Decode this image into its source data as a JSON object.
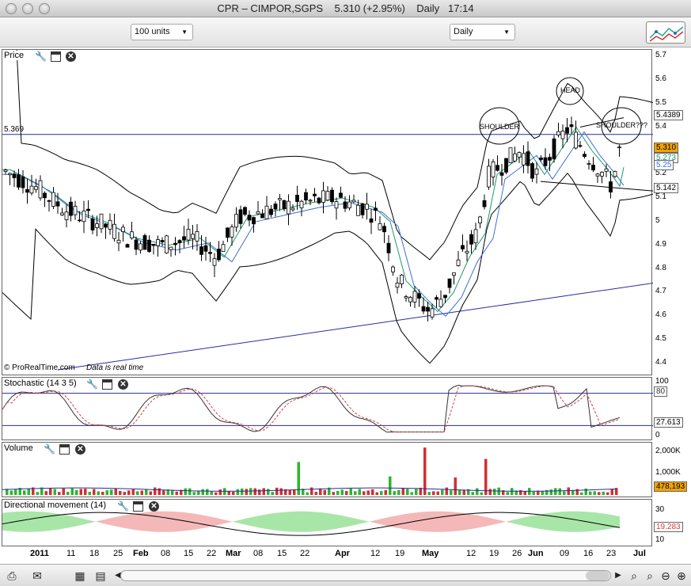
{
  "window": {
    "symbol": "CPR – CIMPOR,SGPS",
    "price": "5.310",
    "change": "(+2.95%)",
    "interval": "Daily",
    "time": "17:14"
  },
  "toolbar": {
    "units_select": "100 units",
    "period_select": "Daily",
    "chart_tool_icon": "chart-indicators-icon"
  },
  "price_panel": {
    "label": "Price",
    "credit": "© ProRealTime.com",
    "realtime_note": "Data is real time",
    "level_line_label": "5.369",
    "y_ticks": [
      "5.7",
      "5.6",
      "5.5",
      "5.4",
      "5.3",
      "5.2",
      "5.1",
      "5",
      "4.9",
      "4.8",
      "4.7",
      "4.6",
      "4.5",
      "4.4"
    ],
    "price_box": "5.310",
    "upper_box": "5.4389",
    "ma_box_1": "5.273",
    "ma_box_2": "5.25",
    "lower_box": "5.142",
    "annotations": [
      "SHOULDER",
      "HEAD",
      "SHOULDER???"
    ]
  },
  "stochastic_panel": {
    "label": "Stochastic (14 3 5)",
    "y_ticks": [
      "100",
      "80",
      "20",
      "0"
    ],
    "value_80": "80",
    "value_box": "27.613"
  },
  "volume_panel": {
    "label": "Volume",
    "y_ticks": [
      "2,000K",
      "1,000K"
    ],
    "value_box": "478,193"
  },
  "dm_panel": {
    "label": "Directional movement (14)",
    "y_ticks": [
      "30",
      "10"
    ],
    "value_box": "19.283"
  },
  "xaxis": {
    "labels": [
      "2011",
      "11",
      "18",
      "25",
      "Feb",
      "08",
      "15",
      "22",
      "Mar",
      "08",
      "15",
      "22",
      "Apr",
      "12",
      "19",
      "May",
      "12",
      "19",
      "26",
      "Jun",
      "09",
      "16",
      "23",
      "Jul"
    ]
  },
  "colors": {
    "up": "#2db52d",
    "down": "#d03030",
    "line_blue": "#2a2aa0",
    "ma_green": "#1c9a6a",
    "ma_blue": "#3b6fd6"
  },
  "statusbar": {
    "icons": [
      "print-icon",
      "email-icon",
      "export-icon",
      "layout-icon",
      "scroll-left-icon",
      "scroll-right-icon",
      "zoom-fit-icon",
      "zoom-reset-icon",
      "zoom-out-icon",
      "zoom-in-icon"
    ]
  }
}
